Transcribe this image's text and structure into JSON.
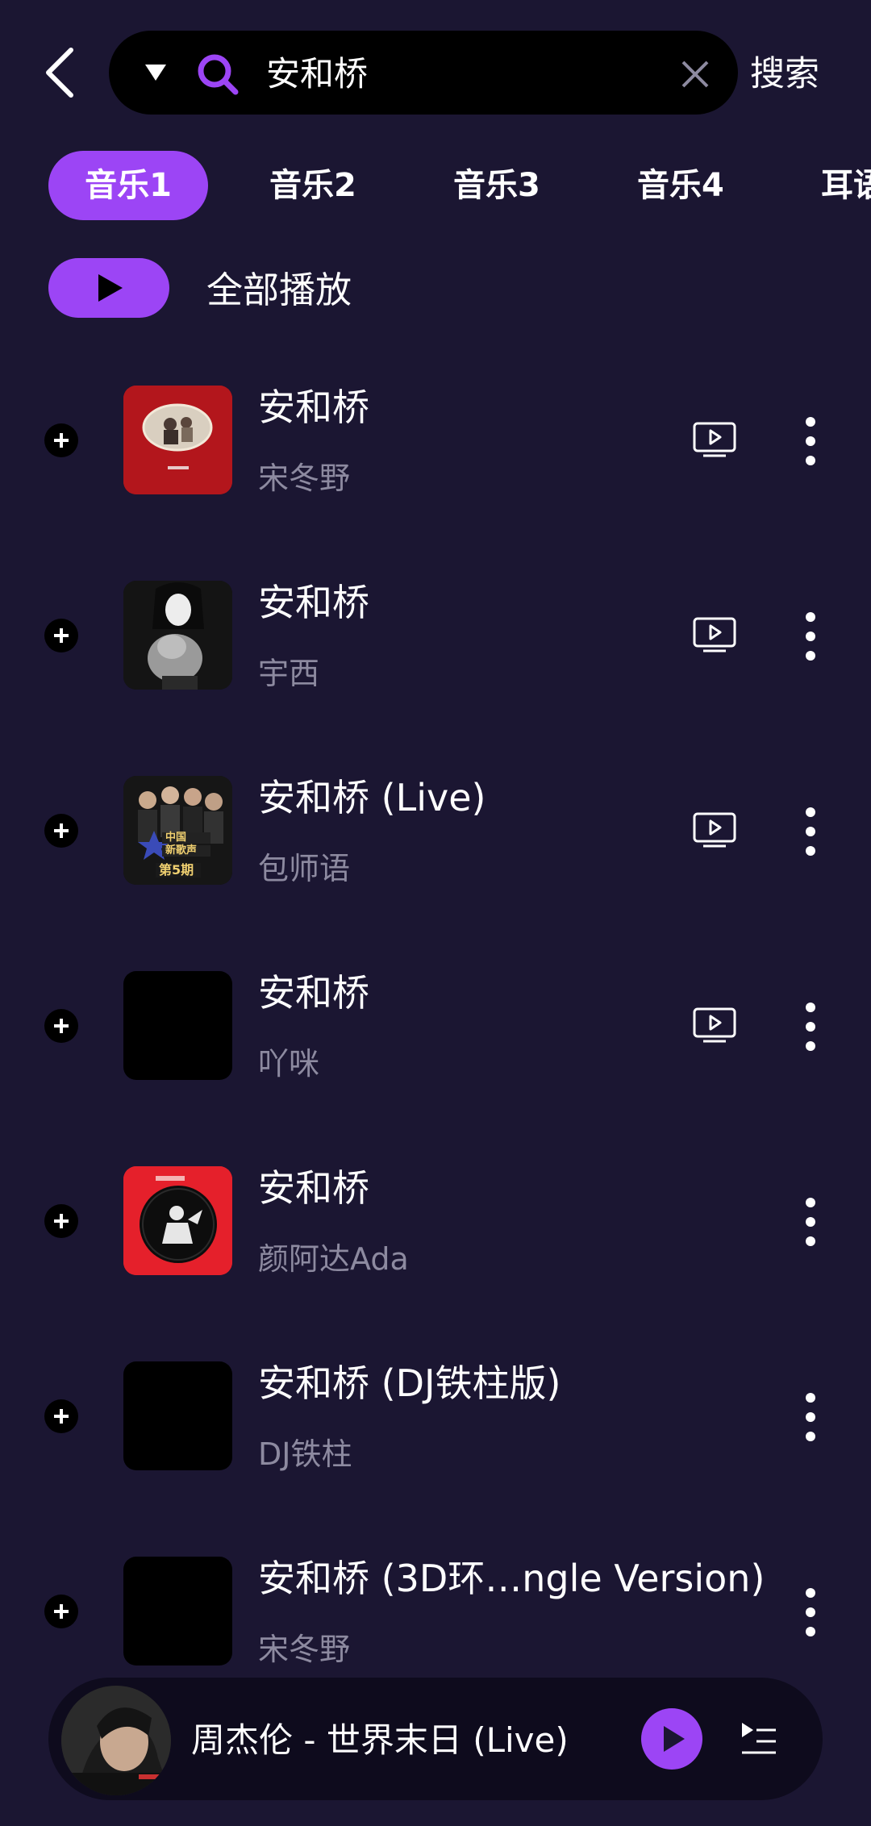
{
  "search": {
    "query": "安和桥",
    "button_label": "搜索"
  },
  "tabs": [
    {
      "label": "音乐1",
      "active": true
    },
    {
      "label": "音乐2",
      "active": false
    },
    {
      "label": "音乐3",
      "active": false
    },
    {
      "label": "音乐4",
      "active": false
    },
    {
      "label": "耳语",
      "active": false
    }
  ],
  "play_all_label": "全部播放",
  "songs": [
    {
      "title": "安和桥",
      "artist": "宋冬野",
      "has_mv": true,
      "cover": "red-album-cover"
    },
    {
      "title": "安和桥",
      "artist": "宇西",
      "has_mv": true,
      "cover": "girl-with-cat-cover"
    },
    {
      "title": "安和桥 (Live)",
      "artist": "包师语",
      "has_mv": true,
      "cover": "中国新歌声 第5期"
    },
    {
      "title": "安和桥",
      "artist": "吖咪",
      "has_mv": true,
      "cover": "black-cover"
    },
    {
      "title": "安和桥",
      "artist": "颜阿达Ada",
      "has_mv": false,
      "cover": "red-vinyl-cover"
    },
    {
      "title": "安和桥 (DJ铁柱版)",
      "artist": "DJ铁柱",
      "has_mv": false,
      "cover": "black-cover"
    },
    {
      "title": "安和桥 (3D环…ngle Version)",
      "artist": "宋冬野",
      "has_mv": false,
      "cover": "black-cover"
    }
  ],
  "now_playing": {
    "title": "周杰伦 - 世界末日 (Live)"
  },
  "colors": {
    "background": "#1b1632",
    "accent": "#9c45f5",
    "secondary_text": "#8d8aa0"
  }
}
